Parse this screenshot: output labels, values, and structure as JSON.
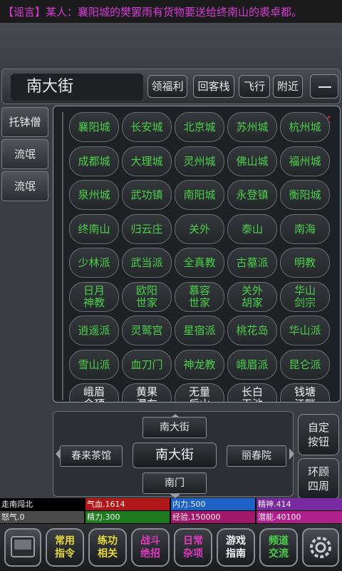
{
  "rumor": "【谣言】某人：襄阳城的樊罢雨有货物要送给终南山的裘卓都。",
  "location": {
    "title": "南大街",
    "buttons": [
      "领福利",
      "回客栈",
      "飞行",
      "附近"
    ]
  },
  "npcs": [
    "托钵僧",
    "流氓",
    "流氓"
  ],
  "map_grid": [
    "襄阳城",
    "长安城",
    "北京城",
    "苏州城",
    "杭州城",
    "成都城",
    "大理城",
    "灵州城",
    "佛山城",
    "福州城",
    "泉州城",
    "武功镇",
    "南阳城",
    "永登镇",
    "衡阳城",
    "终南山",
    "归云庄",
    "关外",
    "泰山",
    "南海",
    "少林派",
    "武当派",
    "全真教",
    "古墓派",
    "明教",
    "日月\n神教",
    "欧阳\n世家",
    "慕容\n世家",
    "关外\n胡家",
    "华山\n剑宗",
    "逍遥派",
    "灵鹫宫",
    "星宿派",
    "桃花岛",
    "华山派",
    "雪山派",
    "血刀门",
    "神龙教",
    "峨眉派",
    "昆仑派",
    "峨眉\n金顶",
    "黄果\n瀑布",
    "无量\n后山",
    "长白\n天池",
    "钱塘\n江畔"
  ],
  "nav": {
    "north": "南大街",
    "west": "春来茶馆",
    "current": "南大街",
    "east": "丽春院",
    "south": "南门"
  },
  "side_buttons": [
    "自定\n按钮",
    "环顾\n四周"
  ],
  "stats": {
    "row1": [
      {
        "label": "走南闯北",
        "color": "#000000"
      },
      {
        "label": "气血.1614",
        "color": "#b01818"
      },
      {
        "label": "内力.500",
        "color": "#1e62c8"
      },
      {
        "label": "精神.414",
        "color": "#7a2aa0"
      }
    ],
    "row2": [
      {
        "label": "怒气.0",
        "color": "#4a4a4a"
      },
      {
        "label": "精力.300",
        "color": "#1e7a1e"
      },
      {
        "label": "经验.150000",
        "color": "#a0186a"
      },
      {
        "label": "潜能.40100",
        "color": "#b0208a"
      }
    ]
  },
  "bottom_menu": [
    {
      "label": "常用\n指令",
      "color": "#e8d83a"
    },
    {
      "label": "练功\n相关",
      "color": "#e8d83a"
    },
    {
      "label": "战斗\n绝招",
      "color": "#e03ac0"
    },
    {
      "label": "日常\n杂项",
      "color": "#e03ac0"
    },
    {
      "label": "游戏\n指南",
      "color": "#f2f2f2"
    },
    {
      "label": "频道\n交流",
      "color": "#4cd04c"
    }
  ]
}
